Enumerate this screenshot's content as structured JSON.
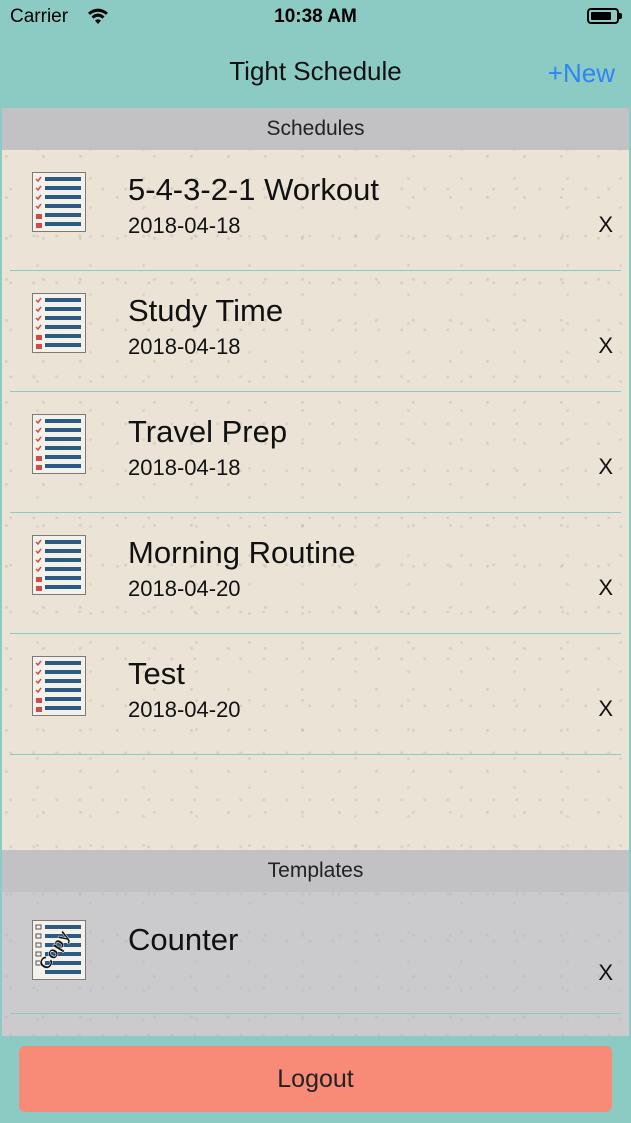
{
  "status_bar": {
    "carrier": "Carrier",
    "time": "10:38 AM"
  },
  "nav": {
    "title": "Tight Schedule",
    "new_label": "+New"
  },
  "schedules": {
    "header": "Schedules",
    "items": [
      {
        "title": "5-4-3-2-1 Workout",
        "date": "2018-04-18",
        "delete": "X"
      },
      {
        "title": "Study Time",
        "date": "2018-04-18",
        "delete": "X"
      },
      {
        "title": "Travel Prep",
        "date": "2018-04-18",
        "delete": "X"
      },
      {
        "title": "Morning Routine",
        "date": "2018-04-20",
        "delete": "X"
      },
      {
        "title": "Test",
        "date": "2018-04-20",
        "delete": "X"
      }
    ]
  },
  "templates": {
    "header": "Templates",
    "items": [
      {
        "title": "Counter",
        "delete": "X",
        "badge": "Copy"
      }
    ]
  },
  "footer": {
    "logout_label": "Logout"
  },
  "colors": {
    "accent": "#8ccbc4",
    "link": "#2f86f0",
    "logout": "#f78b78",
    "section_header": "#c2c1c4",
    "icon_lines": "#2b5a84",
    "checks": "#d04b4b"
  }
}
